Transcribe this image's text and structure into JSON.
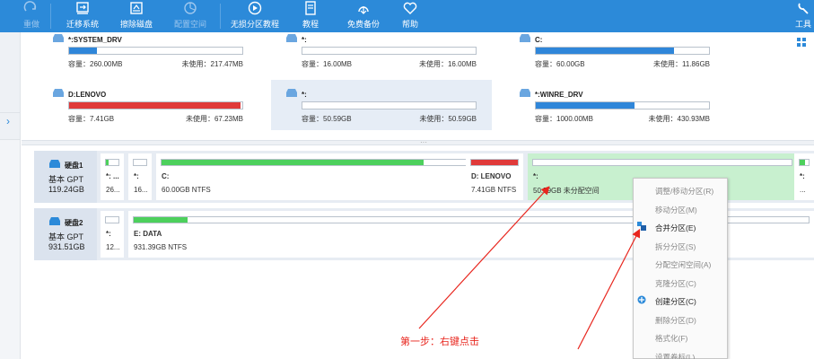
{
  "toolbar": {
    "undo": "重做",
    "migrate": "迁移系统",
    "wipe": "擦除磁盘",
    "allocate": "配置空间",
    "no_loss_tutorial": "无损分区教程",
    "tutorial": "教程",
    "free_backup": "免费备份",
    "help": "帮助",
    "tools": "工具"
  },
  "colors": {
    "toolbar": "#2c8ad9",
    "used_blue": "#2f86d9",
    "used_red": "#e03a3a",
    "used_green": "#4dd05c",
    "unallocated": "#c8f0cf",
    "annotation": "#e8261e"
  },
  "cards": [
    {
      "name": "*:SYSTEM_DRV",
      "cap": "容量：260.00MB",
      "free": "未使用：217.47MB",
      "used_fraction": 0.16,
      "color": "#2f86d9"
    },
    {
      "name": "*:",
      "cap": "容量：16.00MB",
      "free": "未使用：16.00MB",
      "used_fraction": 0.0,
      "color": "#2f86d9"
    },
    {
      "name": "C:",
      "cap": "容量：60.00GB",
      "free": "未使用：11.86GB",
      "used_fraction": 0.8,
      "color": "#2f86d9"
    },
    {
      "name": "D:LENOVO",
      "cap": "容量：7.41GB",
      "free": "未使用：67.23MB",
      "used_fraction": 0.99,
      "color": "#e03a3a"
    },
    {
      "name": "*:",
      "cap": "容量：50.59GB",
      "free": "未使用：50.59GB",
      "used_fraction": 0.0,
      "color": "#2f86d9"
    },
    {
      "name": "*:WINRE_DRV",
      "cap": "容量：1000.00MB",
      "free": "未使用：430.93MB",
      "used_fraction": 0.57,
      "color": "#2f86d9"
    }
  ],
  "disk1": {
    "name": "硬盘1",
    "type": "基本 GPT",
    "size": "119.24GB",
    "parts": [
      {
        "label": "*: ...",
        "info": "26...",
        "used_fraction": 0.2
      },
      {
        "label": "*:",
        "info": "16...",
        "used_fraction": 0.0
      },
      {
        "label": "C:",
        "info": "60.00GB NTFS",
        "used_fraction": 0.8
      },
      {
        "label": "D: LENOVO",
        "info": "7.41GB NTFS",
        "used_fraction": 1.0
      },
      {
        "label": "*:",
        "info": "50.59GB 未分配空间",
        "used_fraction": 0.0
      },
      {
        "label": "*:",
        "info": "...",
        "used_fraction": 0.6
      }
    ]
  },
  "disk2": {
    "name": "硬盘2",
    "type": "基本 GPT",
    "size": "931.51GB",
    "parts": [
      {
        "label": "*:",
        "info": "12...",
        "used_fraction": 0.0
      },
      {
        "label": "E: DATA",
        "info": "931.39GB NTFS",
        "used_fraction": 0.08
      }
    ]
  },
  "context_menu": [
    {
      "label": "调整/移动分区(R)",
      "enabled": false,
      "icon": ""
    },
    {
      "label": "移动分区(M)",
      "enabled": false,
      "icon": ""
    },
    {
      "label": "合并分区(E)",
      "enabled": true,
      "icon": "merge-icon"
    },
    {
      "label": "拆分分区(S)",
      "enabled": false,
      "icon": ""
    },
    {
      "label": "分配空闲空间(A)",
      "enabled": false,
      "icon": ""
    },
    {
      "label": "克隆分区(C)",
      "enabled": false,
      "icon": ""
    },
    {
      "label": "创建分区(C)",
      "enabled": true,
      "icon": "create-partition-icon"
    },
    {
      "label": "删除分区(D)",
      "enabled": false,
      "icon": ""
    },
    {
      "label": "格式化(F)",
      "enabled": false,
      "icon": ""
    },
    {
      "label": "设置卷标(L)",
      "enabled": false,
      "icon": ""
    }
  ],
  "annotation": "第一步：右键点击"
}
